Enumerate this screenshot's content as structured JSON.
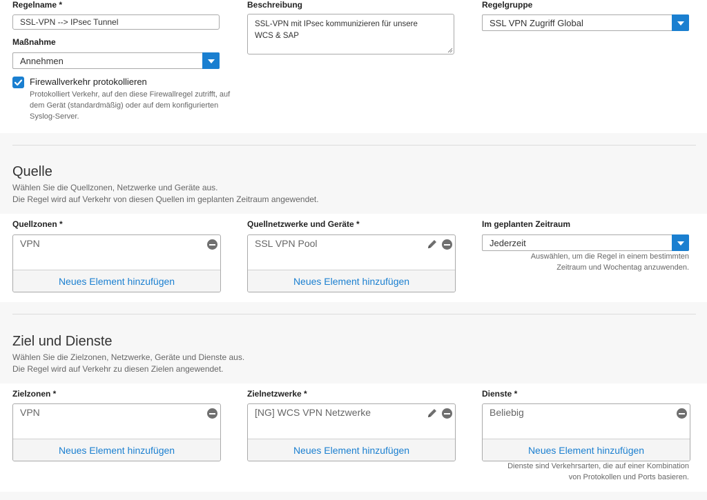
{
  "rule": {
    "name_label": "Regelname *",
    "name_value": "SSL-VPN --> IPsec Tunnel",
    "action_label": "Maßnahme",
    "action_value": "Annehmen",
    "log_label": "Firewallverkehr protokollieren",
    "log_checked": true,
    "log_help": [
      "Protokolliert Verkehr, auf den diese Firewallregel zutrifft, auf",
      "dem Gerät (standardmäßig) oder auf dem konfigurierten",
      "Syslog-Server."
    ],
    "desc_label": "Beschreibung",
    "desc_value": [
      "SSL-VPN mit IPsec kommunizieren für unsere",
      "WCS & SAP"
    ],
    "group_label": "Regelgruppe",
    "group_value": "SSL VPN Zugriff Global"
  },
  "source": {
    "title": "Quelle",
    "desc": [
      "Wählen Sie die Quellzonen, Netzwerke und Geräte aus.",
      "Die Regel wird auf Verkehr von diesen Quellen im geplanten Zeitraum angewendet."
    ],
    "zones_label": "Quellzonen *",
    "zones_item": "VPN",
    "networks_label": "Quellnetzwerke und Geräte *",
    "networks_item": "SSL VPN Pool",
    "schedule_label": "Im geplanten Zeitraum",
    "schedule_value": "Jederzeit",
    "schedule_hint": [
      "Auswählen, um die Regel in einem bestimmten",
      "Zeitraum und Wochentag anzuwenden."
    ],
    "add_label": "Neues Element hinzufügen"
  },
  "destination": {
    "title": "Ziel und Dienste",
    "desc": [
      "Wählen Sie die Zielzonen, Netzwerke, Geräte und Dienste aus.",
      "Die Regel wird auf Verkehr zu diesen Zielen angewendet."
    ],
    "zones_label": "Zielzonen *",
    "zones_item": "VPN",
    "networks_label": "Zielnetzwerke *",
    "networks_item": "[NG] WCS VPN Netzwerke",
    "services_label": "Dienste *",
    "services_item": "Beliebig",
    "services_hint": [
      "Dienste sind Verkehrsarten, die auf einer Kombination",
      "von Protokollen und Ports basieren."
    ],
    "add_label": "Neues Element hinzufügen"
  },
  "colors": {
    "accent": "#1a7fd0",
    "band": "#f7f7f7"
  }
}
